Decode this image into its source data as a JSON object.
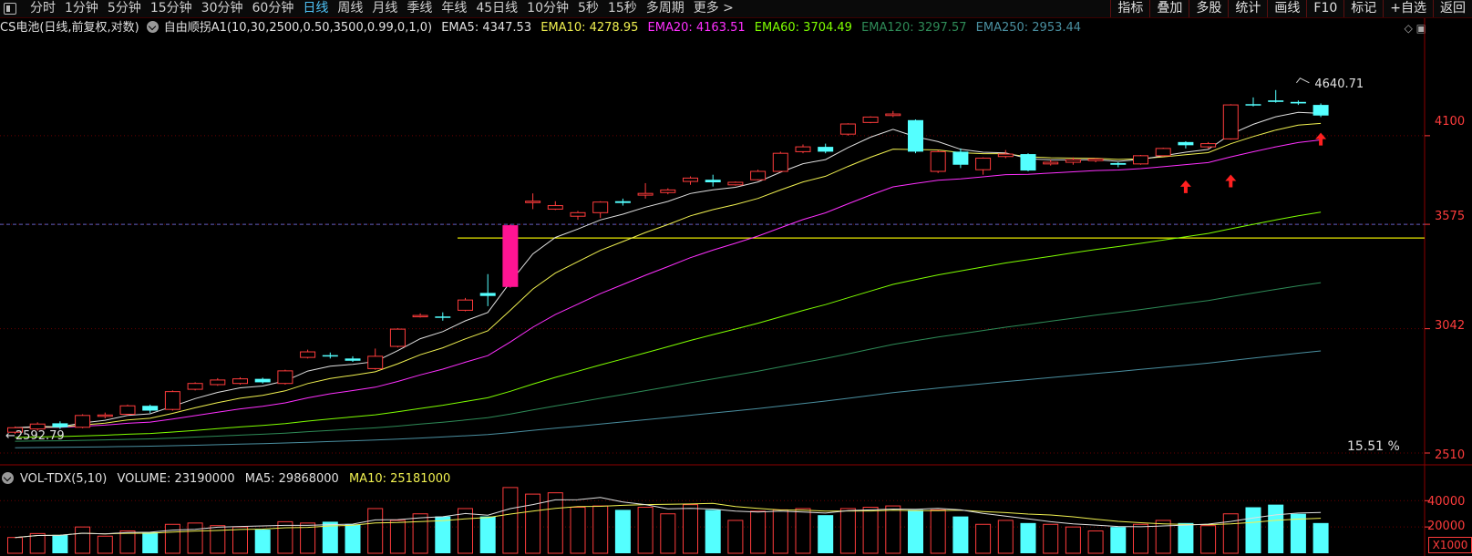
{
  "toolbar": {
    "periods": [
      "分时",
      "1分钟",
      "5分钟",
      "15分钟",
      "30分钟",
      "60分钟",
      "日线",
      "周线",
      "月线",
      "季线",
      "年线",
      "45日线",
      "10分钟",
      "5秒",
      "15秒",
      "多周期",
      "更多 >"
    ],
    "active_period": "日线",
    "right_buttons": [
      "指标",
      "叠加",
      "多股",
      "统计",
      "画线",
      "F10",
      "标记",
      "+自选",
      "返回"
    ]
  },
  "info": {
    "title": "CS电池(日线,前复权,对数)",
    "formula": "自由顺拐A1(10,30,2500,0.50,3500,0.99,0,1,0)",
    "ema5": "EMA5: 4347.53",
    "ema10": "EMA10: 4278.95",
    "ema20": "EMA20: 4163.51",
    "ema60": "EMA60: 3704.49",
    "ema120": "EMA120: 3297.57",
    "ema250": "EMA250: 2953.44"
  },
  "price_labels": {
    "high": "4640.71",
    "low": "2592.79",
    "pct": "15.51 %"
  },
  "price_axis": [
    "4100",
    "3575",
    "3042",
    "2510"
  ],
  "volume": {
    "name": "VOL-TDX(5,10)",
    "volume": "VOLUME: 23190000",
    "ma5": "MA5: 29868000",
    "ma10": "MA10: 25181000",
    "axis": [
      "40000",
      "20000"
    ],
    "unit": "X1000"
  },
  "colors": {
    "up": "#ff3c3c",
    "down": "#54ffff",
    "ema5": "#e0e0e0",
    "ema10": "#f0f050",
    "ema20": "#ff30ff",
    "ema60": "#7fff00",
    "ema120": "#2e8b57",
    "ema250": "#4a8fa0"
  },
  "chart_data": {
    "type": "candlestick",
    "ylabel": "",
    "ylim": [
      2510,
      4700
    ],
    "candles": [
      [
        2592,
        2610,
        2585,
        2615
      ],
      [
        2605,
        2625,
        2598,
        2632
      ],
      [
        2628,
        2612,
        2605,
        2636
      ],
      [
        2612,
        2660,
        2608,
        2665
      ],
      [
        2660,
        2662,
        2648,
        2672
      ],
      [
        2665,
        2700,
        2660,
        2705
      ],
      [
        2700,
        2680,
        2670,
        2705
      ],
      [
        2685,
        2760,
        2680,
        2765
      ],
      [
        2770,
        2795,
        2765,
        2800
      ],
      [
        2790,
        2810,
        2785,
        2818
      ],
      [
        2795,
        2815,
        2790,
        2822
      ],
      [
        2815,
        2800,
        2795,
        2820
      ],
      [
        2795,
        2850,
        2790,
        2855
      ],
      [
        2910,
        2935,
        2905,
        2945
      ],
      [
        2920,
        2915,
        2905,
        2932
      ],
      [
        2905,
        2895,
        2890,
        2915
      ],
      [
        2860,
        2915,
        2855,
        2950
      ],
      [
        2960,
        3040,
        2955,
        3045
      ],
      [
        3100,
        3105,
        3095,
        3115
      ],
      [
        3100,
        3095,
        3080,
        3120
      ],
      [
        3130,
        3180,
        3125,
        3190
      ],
      [
        3215,
        3200,
        3150,
        3310
      ],
      [
        3245,
        3570,
        3240,
        3575
      ],
      [
        3700,
        3705,
        3660,
        3750
      ],
      [
        3660,
        3680,
        3655,
        3705
      ],
      [
        3620,
        3640,
        3600,
        3650
      ],
      [
        3640,
        3700,
        3610,
        3705
      ],
      [
        3705,
        3695,
        3680,
        3720
      ],
      [
        3740,
        3750,
        3720,
        3810
      ],
      [
        3755,
        3770,
        3745,
        3780
      ],
      [
        3820,
        3840,
        3800,
        3850
      ],
      [
        3830,
        3815,
        3790,
        3860
      ],
      [
        3800,
        3815,
        3795,
        3820
      ],
      [
        3830,
        3880,
        3825,
        3890
      ],
      [
        3880,
        3990,
        3875,
        4000
      ],
      [
        4000,
        4030,
        3990,
        4045
      ],
      [
        4030,
        4000,
        3990,
        4050
      ],
      [
        4110,
        4175,
        4100,
        4180
      ],
      [
        4185,
        4220,
        4180,
        4225
      ],
      [
        4230,
        4240,
        4220,
        4260
      ],
      [
        4200,
        4000,
        3990,
        4205
      ],
      [
        3880,
        4000,
        3870,
        4010
      ],
      [
        4000,
        3920,
        3900,
        4020
      ],
      [
        3890,
        3960,
        3860,
        3965
      ],
      [
        3970,
        3985,
        3960,
        4010
      ],
      [
        3985,
        3885,
        3880,
        3990
      ],
      [
        3925,
        3935,
        3915,
        3950
      ],
      [
        3935,
        3950,
        3920,
        3965
      ],
      [
        3945,
        3955,
        3935,
        3960
      ],
      [
        3930,
        3920,
        3905,
        3935
      ],
      [
        3925,
        3975,
        3920,
        3980
      ],
      [
        3975,
        4020,
        3970,
        4025
      ],
      [
        4060,
        4040,
        4020,
        4065
      ],
      [
        4030,
        4050,
        4020,
        4060
      ],
      [
        4080,
        4300,
        4075,
        4305
      ],
      [
        4305,
        4300,
        4290,
        4350
      ],
      [
        4330,
        4320,
        4315,
        4400
      ],
      [
        4320,
        4310,
        4300,
        4330
      ],
      [
        4300,
        4230,
        4220,
        4310
      ]
    ],
    "volumes": [
      12,
      15,
      14,
      20,
      13,
      17,
      16,
      22,
      23,
      21,
      20,
      18,
      24,
      23,
      24,
      22,
      34,
      25,
      30,
      28,
      34,
      28,
      50,
      45,
      46,
      35,
      36,
      33,
      35,
      30,
      37,
      33,
      25,
      32,
      33,
      34,
      29,
      34,
      35,
      36,
      33,
      33,
      28,
      22,
      25,
      23,
      22,
      20,
      17,
      20,
      22,
      25,
      23,
      21,
      30,
      35,
      37,
      30,
      23
    ]
  }
}
